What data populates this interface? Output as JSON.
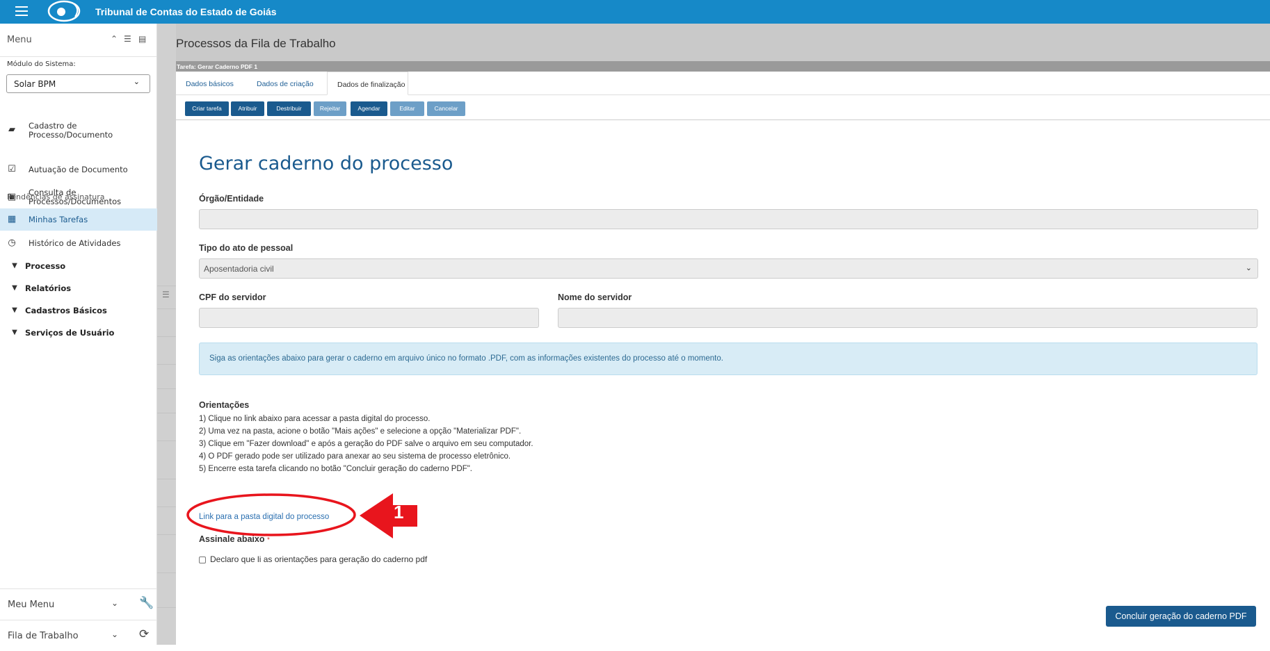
{
  "header": {
    "title": "Tribunal de Contas do Estado de Goiás"
  },
  "sidebar": {
    "menu_label": "Menu",
    "module_label": "Módulo do Sistema:",
    "module_value": "Solar BPM",
    "items": [
      {
        "line1": "Cadastro de",
        "line2": "Processo/Documento",
        "icon": "folder-plus-icon"
      },
      {
        "label": "Autuação de Documento",
        "icon": "checkbox-icon"
      },
      {
        "line1": "Consulta de",
        "line2": "Processos/Documentos",
        "icon": "clipboard-icon"
      }
    ],
    "pendencias": "Pendências de assinatura",
    "active_item": "Minhas Tarefas",
    "historico": "Histórico de Atividades",
    "sections": [
      "Processo",
      "Relatórios",
      "Cadastros Básicos",
      "Serviços de Usuário"
    ],
    "meu_menu": "Meu Menu",
    "fila": "Fila de Trabalho"
  },
  "page": {
    "title": "Processos da Fila de Trabalho",
    "task_label": "Tarefa: Gerar Caderno PDF 1",
    "tabs": [
      "Dados básicos",
      "Dados de criação",
      "Dados de finalização"
    ],
    "buttons": [
      "Criar tarefa",
      "Atribuir",
      "Destribuir",
      "Rejeitar",
      "Agendar",
      "Editar",
      "Cancelar"
    ]
  },
  "form": {
    "title": "Gerar caderno do processo",
    "orgao_label": "Órgão/Entidade",
    "orgao_value": "",
    "tipo_label": "Tipo do ato de pessoal",
    "tipo_value": "Aposentadoria civil",
    "cpf_label": "CPF do servidor",
    "cpf_value": "",
    "nome_label": "Nome do servidor",
    "nome_value": "",
    "info": "Siga as orientações abaixo para gerar o caderno em arquivo único no formato .PDF, com as informações existentes do processo até o momento.",
    "orientacoes_title": "Orientações",
    "orientacoes": [
      "1) Clique no link abaixo para acessar a pasta digital do processo.",
      "2) Uma vez na pasta, acione o botão \"Mais ações\" e selecione a opção \"Materializar PDF\".",
      "3) Clique em \"Fazer download\" e após a geração do PDF salve o arquivo em seu computador.",
      "4) O PDF gerado pode ser utilizado para anexar ao seu sistema de processo eletrônico.",
      "5) Encerre esta tarefa clicando no botão \"Concluir geração do caderno PDF\"."
    ],
    "link": "Link para a pasta digital do processo",
    "assinale": "Assinale abaixo",
    "required_mark": "*",
    "checkbox_label": "Declaro que li as orientações para geração do caderno pdf",
    "submit": "Concluir geração do caderno PDF"
  },
  "annotation": {
    "number": "1",
    "color": "#e8151d"
  }
}
